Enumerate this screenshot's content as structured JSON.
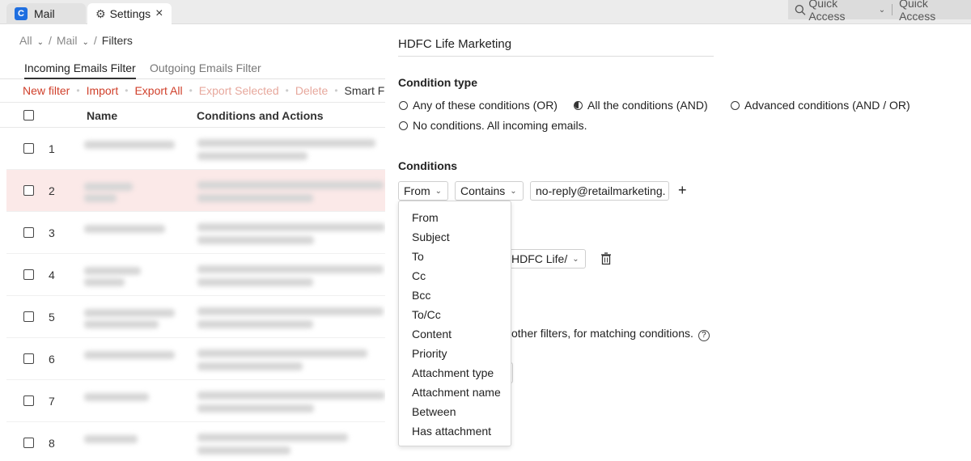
{
  "tabs": [
    {
      "label": "Mail"
    },
    {
      "label": "Settings"
    }
  ],
  "quick_access": {
    "first": "Quick Access",
    "second": "Quick Access"
  },
  "breadcrumb": {
    "all": "All",
    "mail": "Mail",
    "current": "Filters"
  },
  "subtabs": {
    "incoming": "Incoming Emails Filter",
    "outgoing": "Outgoing Emails Filter"
  },
  "actions": {
    "new_filter": "New filter",
    "import": "Import",
    "export_all": "Export All",
    "export_selected": "Export Selected",
    "delete": "Delete",
    "smart": "Smart Fi"
  },
  "table": {
    "headers": {
      "name": "Name",
      "conditions": "Conditions and Actions"
    },
    "rows": [
      {
        "num": "1"
      },
      {
        "num": "2"
      },
      {
        "num": "3"
      },
      {
        "num": "4"
      },
      {
        "num": "5"
      },
      {
        "num": "6"
      },
      {
        "num": "7"
      },
      {
        "num": "8"
      }
    ]
  },
  "panel": {
    "filter_name": "HDFC Life Marketing",
    "condition_type_label": "Condition type",
    "radios": {
      "any": "Any of these conditions (OR)",
      "all": "All the conditions (AND)",
      "advanced": "Advanced conditions (AND / OR)",
      "none": "No conditions. All incoming emails."
    },
    "conditions_label": "Conditions",
    "field_select": "From",
    "operator_select": "Contains",
    "value": "no-reply@retailmarketing.",
    "folder_select": "HDFC Life/",
    "other_filters_text": "other filters, for matching conditions."
  },
  "dropdown_options": [
    "From",
    "Subject",
    "To",
    "Cc",
    "Bcc",
    "To/Cc",
    "Content",
    "Priority",
    "Attachment type",
    "Attachment name",
    "Between",
    "Has attachment"
  ]
}
